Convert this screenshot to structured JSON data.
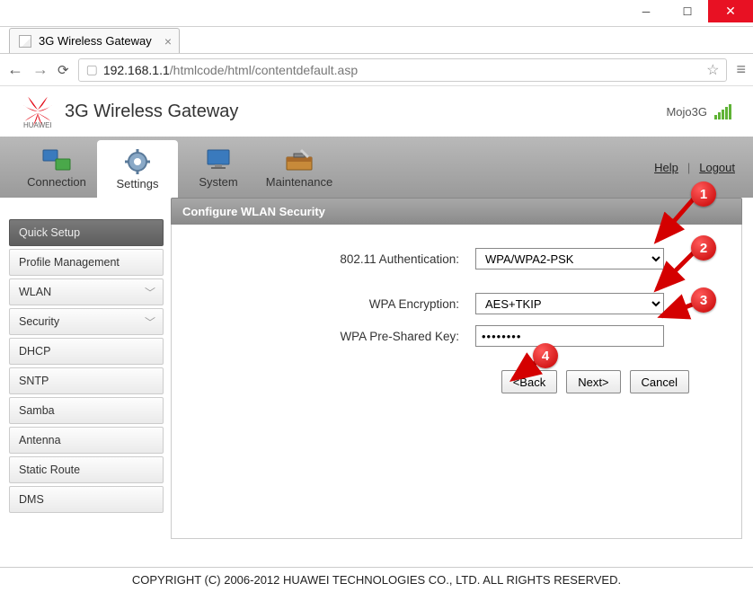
{
  "window": {
    "tab_title": "3G Wireless Gateway",
    "url_host": "192.168.1.1",
    "url_path": "/htmlcode/html/contentdefault.asp"
  },
  "header": {
    "logo_text": "HUAWEI",
    "title": "3G Wireless Gateway",
    "network_name": "Mojo3G"
  },
  "nav": {
    "items": [
      {
        "label": "Connection"
      },
      {
        "label": "Settings"
      },
      {
        "label": "System"
      },
      {
        "label": "Maintenance"
      }
    ],
    "help": "Help",
    "logout": "Logout"
  },
  "sidebar": {
    "items": [
      {
        "label": "Quick Setup",
        "active": true
      },
      {
        "label": "Profile Management"
      },
      {
        "label": "WLAN",
        "expandable": true
      },
      {
        "label": "Security",
        "expandable": true
      },
      {
        "label": "DHCP"
      },
      {
        "label": "SNTP"
      },
      {
        "label": "Samba"
      },
      {
        "label": "Antenna"
      },
      {
        "label": "Static Route"
      },
      {
        "label": "DMS"
      }
    ]
  },
  "panel": {
    "title": "Configure WLAN Security",
    "fields": {
      "auth_label": "802.11 Authentication:",
      "auth_value": "WPA/WPA2-PSK",
      "enc_label": "WPA Encryption:",
      "enc_value": "AES+TKIP",
      "psk_label": "WPA Pre-Shared Key:",
      "psk_value": "••••••••"
    },
    "buttons": {
      "back": "<Back",
      "next": "Next>",
      "cancel": "Cancel"
    }
  },
  "annotations": {
    "b1": "1",
    "b2": "2",
    "b3": "3",
    "b4": "4"
  },
  "footer": {
    "copyright": "COPYRIGHT (C) 2006-2012 HUAWEI TECHNOLOGIES CO., LTD. ALL RIGHTS RESERVED."
  }
}
